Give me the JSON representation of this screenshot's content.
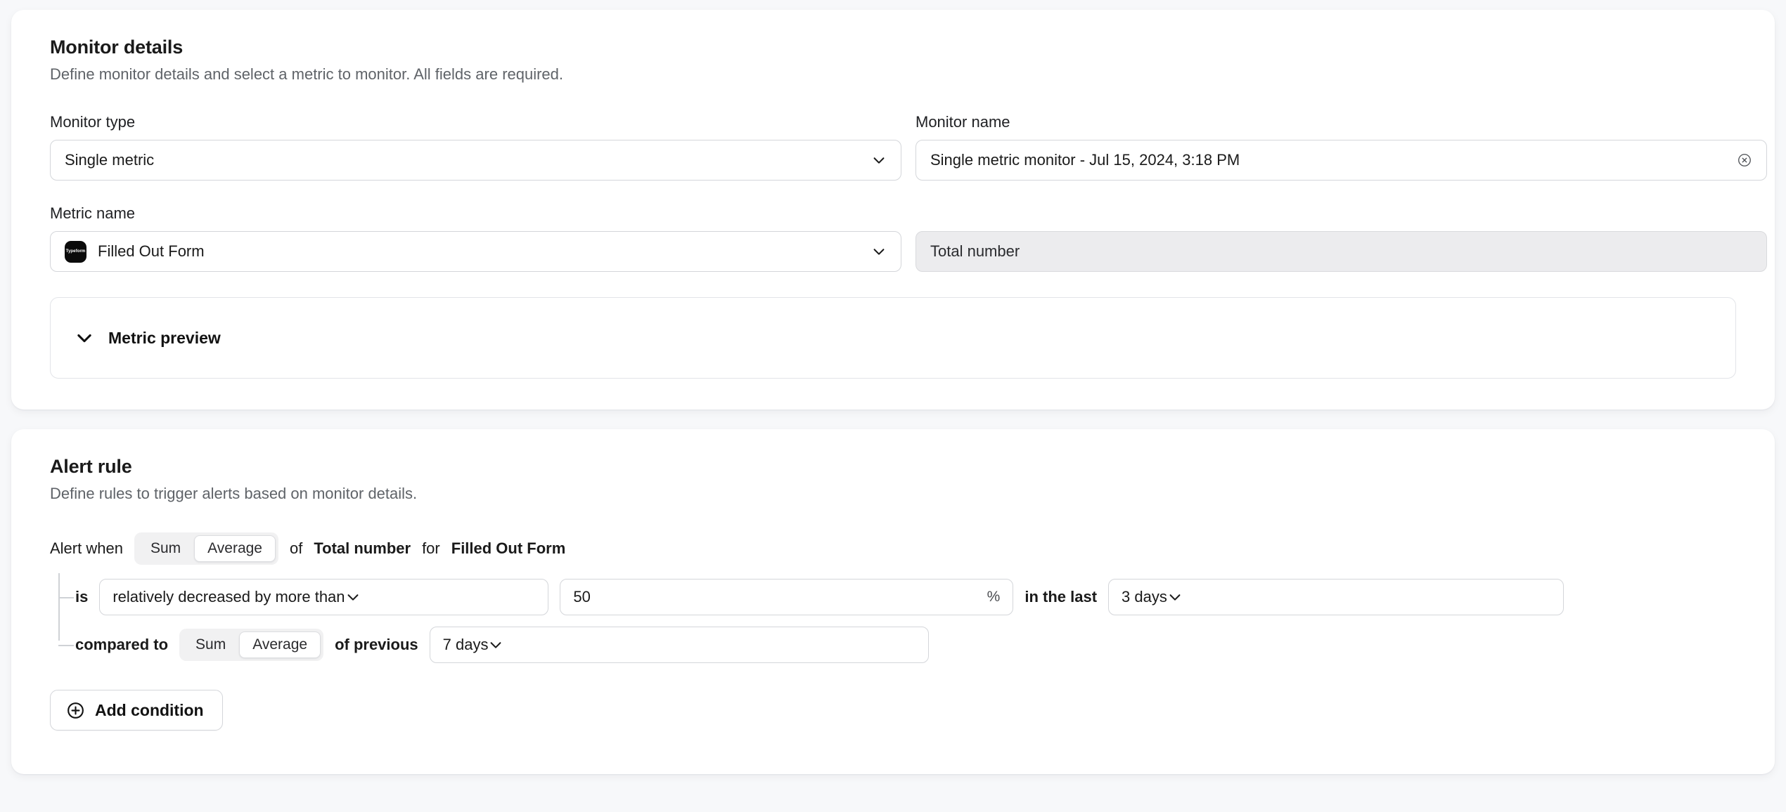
{
  "monitor_details": {
    "title": "Monitor details",
    "description": "Define monitor details and select a metric to monitor. All fields are required.",
    "monitor_type": {
      "label": "Monitor type",
      "value": "Single metric",
      "icon": "chevron-down-icon"
    },
    "monitor_name": {
      "label": "Monitor name",
      "value": "Single metric monitor - Jul 15, 2024, 3:18 PM",
      "clear_icon": "clear-circle-icon"
    },
    "metric_name": {
      "label": "Metric name",
      "value": "Filled Out Form",
      "brand": "Typeform",
      "icon": "chevron-down-icon"
    },
    "metric_aggregation": {
      "value": "Total number",
      "readonly": true
    },
    "metric_preview": {
      "label": "Metric preview",
      "icon": "chevron-down-icon",
      "expanded": false
    }
  },
  "alert_rule": {
    "title": "Alert rule",
    "description": "Define rules to trigger alerts based on monitor details.",
    "root": {
      "prefix": "Alert when",
      "aggregation_options": [
        "Sum",
        "Average"
      ],
      "aggregation_selected": "Average",
      "mid_text": "of",
      "metric_measure": "Total number",
      "joiner": "for",
      "metric_source": "Filled Out Form"
    },
    "conditions": [
      {
        "prefix": "is",
        "operator": "relatively decreased by more than",
        "threshold": "50",
        "threshold_suffix": "%",
        "window_label": "in the last",
        "window": "3 days"
      },
      {
        "prefix": "compared to",
        "aggregation_options": [
          "Sum",
          "Average"
        ],
        "aggregation_selected": "Average",
        "previous_label": "of previous",
        "previous": "7 days"
      }
    ],
    "add_condition": {
      "label": "Add condition",
      "icon": "plus-circle-icon"
    }
  }
}
